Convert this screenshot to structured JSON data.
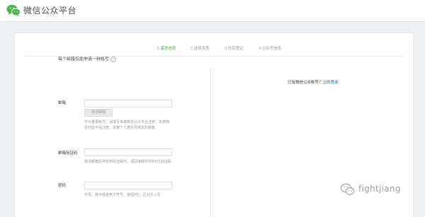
{
  "header": {
    "title": "微信公众平台"
  },
  "steps": [
    {
      "label": "1 基本信息",
      "active": true
    },
    {
      "label": "2 选择类型",
      "active": false
    },
    {
      "label": "3 信息登记",
      "active": false
    },
    {
      "label": "4 公众号信息",
      "active": false
    }
  ],
  "form": {
    "heading": "每个邮箱仅能申请一种帐号",
    "email": {
      "label": "邮箱",
      "value": "",
      "placeholder": "",
      "activate_button": "激活邮箱",
      "help": "作为登录帐号，请填写未被微信公众平台注册，未被微信开放平台注册，未被个人微信号绑定的邮箱"
    },
    "email_code": {
      "label": "邮箱验证码",
      "value": "",
      "placeholder": "",
      "help": "激活邮箱后将收到验证邮件，请回填邮件中的6位验证码"
    },
    "password": {
      "label": "密码",
      "value": "",
      "placeholder": "",
      "help": "字母、数字或者英文符号，最短8位，区分大小写"
    }
  },
  "right": {
    "prompt": "已有微信公众帐号？",
    "login_link": "立即登录"
  },
  "watermark": {
    "text": "fightjiang"
  },
  "colors": {
    "accent": "#44b549",
    "link": "#1c6bb0",
    "background": "#eef0f2",
    "muted": "#9a9a9a"
  }
}
